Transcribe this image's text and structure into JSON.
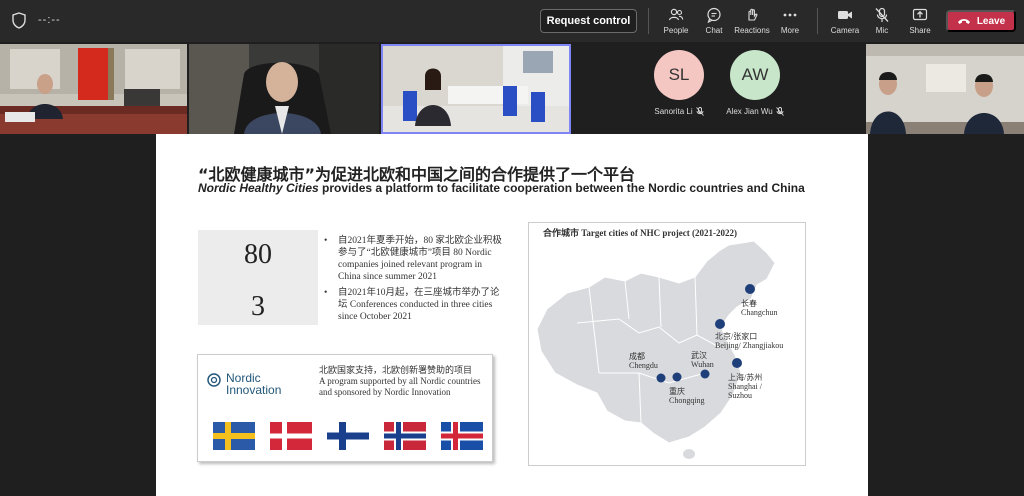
{
  "topbar": {
    "timer": "--:--",
    "request_control": "Request control",
    "tools": [
      {
        "label": "People",
        "icon": "people-icon"
      },
      {
        "label": "Chat",
        "icon": "chat-icon"
      },
      {
        "label": "Reactions",
        "icon": "reactions-icon"
      },
      {
        "label": "More",
        "icon": "more-icon"
      },
      {
        "label": "Camera",
        "icon": "camera-icon"
      },
      {
        "label": "Mic",
        "icon": "mic-off-icon"
      },
      {
        "label": "Share",
        "icon": "share-icon"
      }
    ],
    "leave": "Leave",
    "leave_color": "#c4314b"
  },
  "participants": [
    {
      "initials": "SL",
      "name": "Sanorita Li",
      "color": "#f4c7c3"
    },
    {
      "initials": "AW",
      "name": "Alex Jian Wu",
      "color": "#c8e6c9"
    }
  ],
  "slide": {
    "title_cn": "“北欧健康城市”为促进北欧和中国之间的合作提供了一个平台",
    "title_en_italic": "Nordic Healthy Cities",
    "title_en_rest": " provides a platform to facilitate cooperation between the Nordic countries and China",
    "stats": [
      "80",
      "3"
    ],
    "bullets": [
      "自2021年夏季开始，80 家北欧企业积极参与了“北欧健康城市”项目 80 Nordic companies joined relevant program in China since summer 2021",
      "自2021年10月起，在三座城市举办了论坛 Conferences conducted in three cities since October 2021"
    ],
    "innovation": {
      "logo_line1": "Nordic",
      "logo_line2": "Innovation",
      "desc_cn": "北欧国家支持，北欧创新署赞助的项目",
      "desc_en": "A program supported by all Nordic countries and sponsored by Nordic Innovation",
      "flags": [
        "sweden-flag",
        "denmark-flag",
        "finland-flag",
        "norway-flag",
        "iceland-flag"
      ]
    },
    "map": {
      "title": "合作城市 Target cities of NHC project (2021-2022)",
      "cities": [
        {
          "cn": "长春",
          "en": "Changchun"
        },
        {
          "cn": "北京/张家口",
          "en": "Beijing/ Zhangjiakou"
        },
        {
          "cn": "成都",
          "en": "Chengdu"
        },
        {
          "cn": "武汉",
          "en": "Wuhan"
        },
        {
          "cn": "重庆",
          "en": "Chongqing"
        },
        {
          "cn": "上海/苏州",
          "en": "Shanghai / Suzhou"
        }
      ]
    }
  }
}
